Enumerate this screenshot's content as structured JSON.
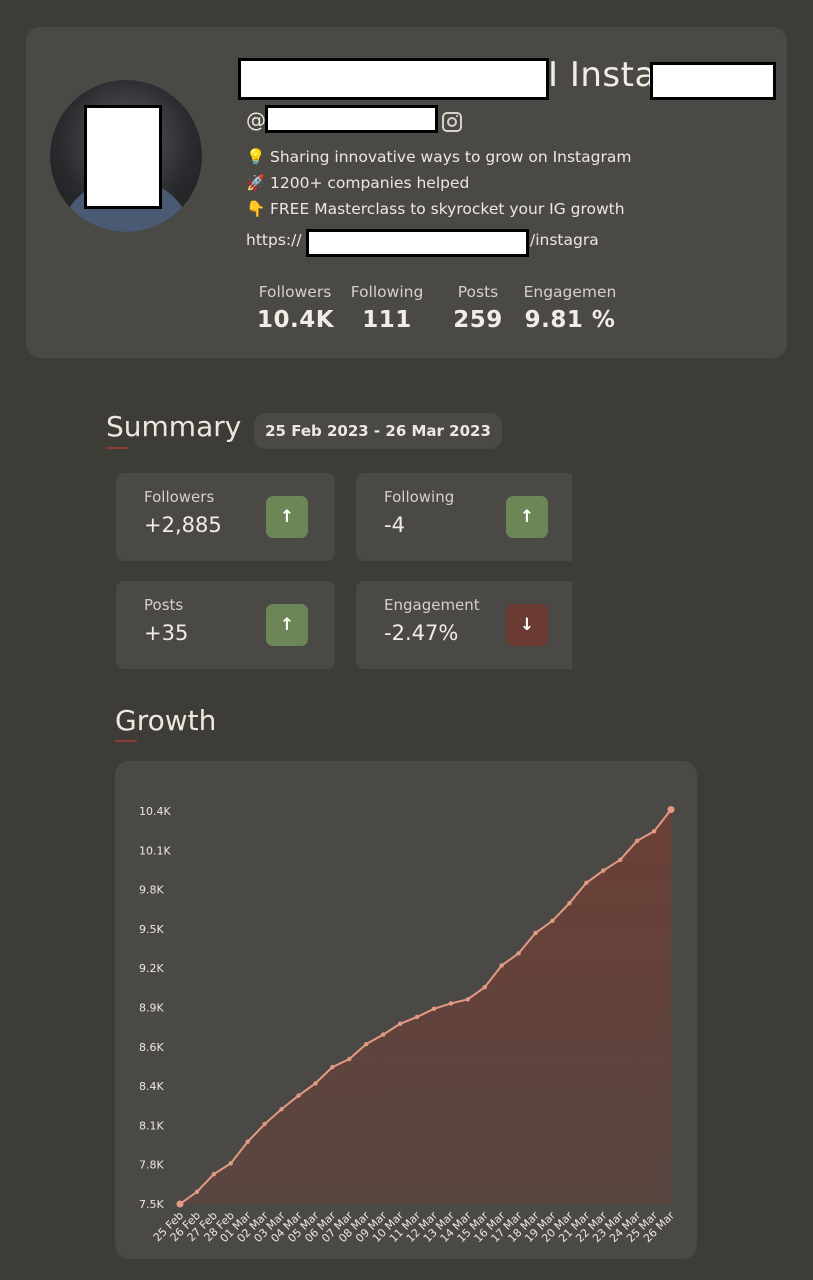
{
  "profile": {
    "name_suffix": "I Insta",
    "handle_prefix": "@",
    "bio": [
      {
        "emoji": "💡",
        "text": "Sharing innovative ways to grow on Instagram"
      },
      {
        "emoji": "🚀",
        "text": "1200+ companies helped"
      },
      {
        "emoji": "👇",
        "text": "FREE Masterclass to skyrocket your IG growth"
      }
    ],
    "url_prefix": "https://",
    "url_suffix": "/instagra",
    "stats": [
      {
        "label": "Followers",
        "value": "10.4K"
      },
      {
        "label": "Following",
        "value": "111"
      },
      {
        "label": "Posts",
        "value": "259"
      },
      {
        "label": "Engagemen",
        "value": "9.81 %"
      }
    ]
  },
  "summary": {
    "title": "Summary",
    "date_range": "25 Feb 2023 - 26 Mar 2023",
    "cards": [
      {
        "label": "Followers",
        "value": "+2,885",
        "trend": "up",
        "arrow": "↑"
      },
      {
        "label": "Following",
        "value": "-4",
        "trend": "up",
        "arrow": "↑"
      },
      {
        "label": "Posts",
        "value": "+35",
        "trend": "up",
        "arrow": "↑"
      },
      {
        "label": "Engagement",
        "value": "-2.47%",
        "trend": "down",
        "arrow": "↓"
      }
    ]
  },
  "growth": {
    "title": "Growth"
  },
  "colors": {
    "background": "#3e3c37",
    "card": "#4b4945",
    "line": "#e39a84",
    "area": "#6a3f36",
    "up": "#6d8657",
    "down": "#6a3a33",
    "underline": "#8a3b34"
  },
  "chart_data": {
    "type": "area",
    "title": "",
    "xlabel": "",
    "ylabel": "",
    "ylim": [
      7500,
      10400
    ],
    "yticks": [
      "7.5K",
      "7.8K",
      "8.1K",
      "8.4K",
      "8.6K",
      "8.9K",
      "9.2K",
      "9.5K",
      "9.8K",
      "10.1K",
      "10.4K"
    ],
    "grid": false,
    "categories": [
      "25 Feb",
      "26 Feb",
      "27 Feb",
      "28 Feb",
      "01 Mar",
      "02 Mar",
      "03 Mar",
      "04 Mar",
      "05 Mar",
      "06 Mar",
      "07 Mar",
      "08 Mar",
      "09 Mar",
      "10 Mar",
      "11 Mar",
      "12 Mar",
      "13 Mar",
      "14 Mar",
      "15 Mar",
      "16 Mar",
      "17 Mar",
      "18 Mar",
      "19 Mar",
      "20 Mar",
      "21 Mar",
      "22 Mar",
      "23 Mar",
      "24 Mar",
      "25 Mar",
      "26 Mar"
    ],
    "series": [
      {
        "values": [
          7500,
          7590,
          7720,
          7800,
          7960,
          8090,
          8200,
          8300,
          8390,
          8510,
          8570,
          8680,
          8750,
          8830,
          8880,
          8940,
          8980,
          9010,
          9100,
          9260,
          9350,
          9500,
          9590,
          9720,
          9870,
          9960,
          10040,
          10180,
          10250,
          10410
        ]
      }
    ]
  }
}
